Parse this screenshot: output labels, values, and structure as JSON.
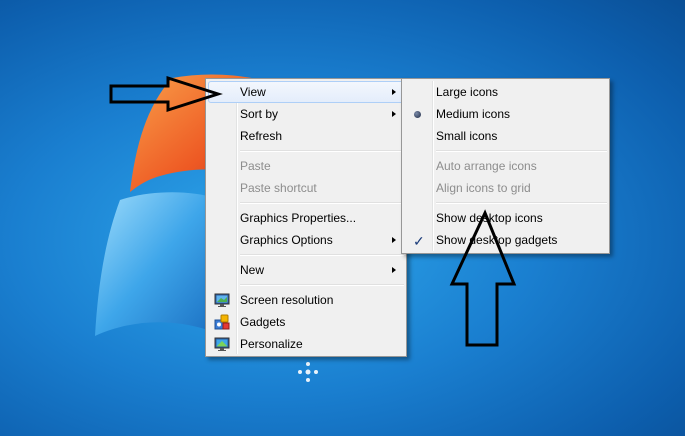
{
  "context_menu": {
    "items": [
      {
        "label": "View",
        "submenu": true,
        "state": "hover"
      },
      {
        "label": "Sort by",
        "submenu": true
      },
      {
        "label": "Refresh"
      },
      {
        "label": "Paste",
        "disabled": true
      },
      {
        "label": "Paste shortcut",
        "disabled": true
      },
      {
        "label": "Graphics Properties..."
      },
      {
        "label": "Graphics Options",
        "submenu": true
      },
      {
        "label": "New",
        "submenu": true
      },
      {
        "label": "Screen resolution",
        "icon": "screen-resolution-icon"
      },
      {
        "label": "Gadgets",
        "icon": "gadgets-icon"
      },
      {
        "label": "Personalize",
        "icon": "personalize-icon"
      }
    ]
  },
  "view_submenu": {
    "items": [
      {
        "label": "Large icons"
      },
      {
        "label": "Medium icons",
        "selected": true
      },
      {
        "label": "Small icons"
      },
      {
        "label": "Auto arrange icons",
        "disabled": true
      },
      {
        "label": "Align icons to grid",
        "disabled": true
      },
      {
        "label": "Show desktop icons"
      },
      {
        "label": "Show desktop gadgets",
        "checked": true
      }
    ]
  },
  "colors": {
    "desktop_blue": "#1a7fd0",
    "menu_background": "#f0f0f0",
    "hover_border": "#aecff7",
    "disabled_text": "#8d8d8d"
  }
}
